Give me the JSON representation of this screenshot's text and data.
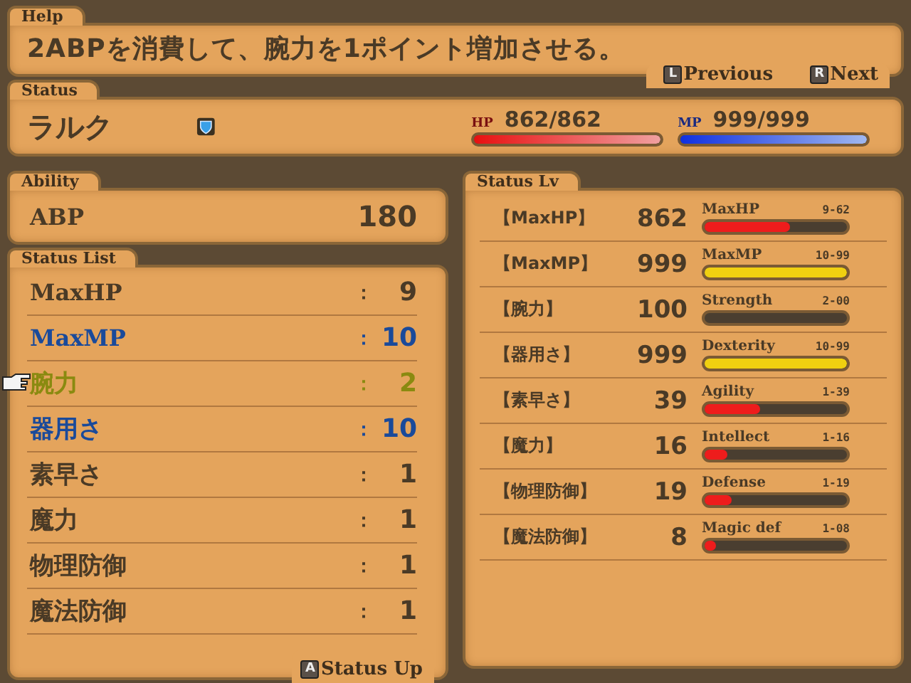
{
  "help": {
    "title": "Help",
    "text": "2ABPを消費して、腕力を1ポイント増加させる。",
    "buttons": [
      {
        "key": "L",
        "label": "Previous"
      },
      {
        "key": "R",
        "label": "Next"
      }
    ]
  },
  "status": {
    "title": "Status",
    "name": "ラルク",
    "hp": {
      "label": "HP",
      "value": "862/862",
      "level": 1
    },
    "mp": {
      "label": "MP",
      "value": "999/999",
      "level": 1
    }
  },
  "ability": {
    "title": "Ability",
    "label": "ABP",
    "value": "180"
  },
  "status_list": {
    "title": "Status List",
    "footer": {
      "key": "A",
      "label": "Status Up"
    },
    "rows": [
      {
        "name": "MaxHP",
        "value": "9",
        "selected": false,
        "maxed": false
      },
      {
        "name": "MaxMP",
        "value": "10",
        "selected": false,
        "maxed": true
      },
      {
        "name": "腕力",
        "value": "2",
        "selected": true,
        "maxed": false
      },
      {
        "name": "器用さ",
        "value": "10",
        "selected": false,
        "maxed": true
      },
      {
        "name": "素早さ",
        "value": "1",
        "selected": false,
        "maxed": false
      },
      {
        "name": "魔力",
        "value": "1",
        "selected": false,
        "maxed": false
      },
      {
        "name": "物理防御",
        "value": "1",
        "selected": false,
        "maxed": false
      },
      {
        "name": "魔法防御",
        "value": "1",
        "selected": false,
        "maxed": false
      }
    ]
  },
  "separator": "：",
  "status_lv": {
    "title": "Status Lv",
    "rows": [
      {
        "name": "【MaxHP】",
        "value": "862",
        "stat": "MaxHP",
        "range": "9-62",
        "level": 0.6,
        "color": "#ee1c1c"
      },
      {
        "name": "【MaxMP】",
        "value": "999",
        "stat": "MaxMP",
        "range": "10-99",
        "level": 1,
        "color": "#f0d010"
      },
      {
        "name": "【腕力】",
        "value": "100",
        "stat": "Strength",
        "range": "2-00"
      },
      {
        "name": "【器用さ】",
        "value": "999",
        "stat": "Dexterity",
        "range": "10-99",
        "level": 1,
        "color": "#f0d010"
      },
      {
        "name": "【素早さ】",
        "value": "39",
        "stat": "Agility",
        "range": "1-39",
        "level": 0.39,
        "color": "#ee1c1c"
      },
      {
        "name": "【魔力】",
        "value": "16",
        "stat": "Intellect",
        "range": "1-16",
        "level": 0.16,
        "color": "#ee1c1c"
      },
      {
        "name": "【物理防御】",
        "value": "19",
        "stat": "Defense",
        "range": "1-19",
        "level": 0.19,
        "color": "#ee1c1c"
      },
      {
        "name": "【魔法防御】",
        "value": "8",
        "stat": "Magic def",
        "range": "1-08",
        "level": 0.08,
        "color": "#ee1c1c"
      }
    ]
  }
}
